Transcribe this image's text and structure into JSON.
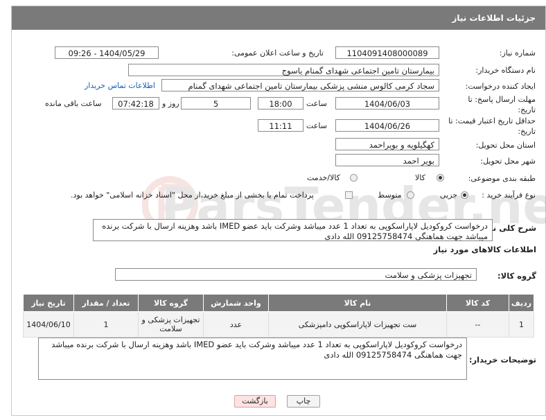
{
  "header": {
    "title": "جزئیات اطلاعات نیاز"
  },
  "fields": {
    "need_number_label": "شماره نیاز:",
    "need_number": "1104091408000089",
    "announce_label": "تاریخ و ساعت اعلان عمومی:",
    "announce_value": "1404/05/29 - 09:26",
    "buyer_org_label": "نام دستگاه خریدار:",
    "buyer_org": "بیمارستان تامین اجتماعی شهدای گمنام یاسوج",
    "creator_label": "ایجاد کننده درخواست:",
    "creator": "سجاد کرمی کالوس  منشی پزشکی  بیمارستان تامین اجتماعی شهدای گمنام",
    "contact_link": "اطلاعات تماس خریدار",
    "deadline_label": "مهلت ارسال پاسخ: تا تاریخ:",
    "deadline_date": "1404/06/03",
    "time_label": "ساعت",
    "deadline_time": "18:00",
    "days_remaining": "5",
    "days_label": "روز و",
    "remaining_time": "07:42:18",
    "remaining_label": "ساعت باقی مانده",
    "validity_label": "حداقل تاریخ اعتبار قیمت: تا تاریخ:",
    "validity_date": "1404/06/26",
    "validity_time": "11:11",
    "province_label": "استان محل تحویل:",
    "province": "کهگیلویه و بویراحمد",
    "city_label": "شهر محل تحویل:",
    "city": "بویر احمد",
    "category_label": "طبقه بندی موضوعی:",
    "category_opt1": "کالا",
    "category_opt2": "کالا/خدمت",
    "process_label": "نوع فرآیند خرید :",
    "process_opt1": "جزیی",
    "process_opt2": "متوسط",
    "payment_note": "پرداخت تمام یا بخشی از مبلغ خرید،از محل \"اسناد خزانه اسلامی\" خواهد بود."
  },
  "summary": {
    "label": "شرح کلی نیاز:",
    "text": "درخواست کروکودیل لاپاراسکوپی به تعداد 1 عدد میباشد وشرکت باید عضو IMED باشد وهزینه ارسال با شرکت برنده میباشد جهت هماهنگی 09125758474 الله دادی"
  },
  "goods_section": {
    "title": "اطلاعات کالاهای مورد نیاز"
  },
  "goods_group": {
    "label": "گروه کالا:",
    "value": "تجهیزات پزشکی و سلامت"
  },
  "table": {
    "headers": [
      "ردیف",
      "کد کالا",
      "نام کالا",
      "واحد شمارش",
      "گروه کالا",
      "تعداد / مقدار",
      "تاریخ نیاز"
    ],
    "rows": [
      [
        "1",
        "--",
        "ست تجهیزات لاپاراسکوپی دامپزشکی",
        "عدد",
        "تجهیزات پزشکی و سلامت",
        "1",
        "1404/06/10"
      ]
    ]
  },
  "buyer_notes": {
    "label": "توضیحات خریدار:",
    "text": "درخواست کروکودیل لاپاراسکوپی به تعداد 1 عدد میباشد وشرکت باید عضو IMED باشد وهزینه ارسال با شرکت برنده میباشد جهت هماهنگی 09125758474 الله دادی"
  },
  "buttons": {
    "print": "چاپ",
    "back": "بازگشت"
  },
  "watermark_text": "ParsTender.net"
}
